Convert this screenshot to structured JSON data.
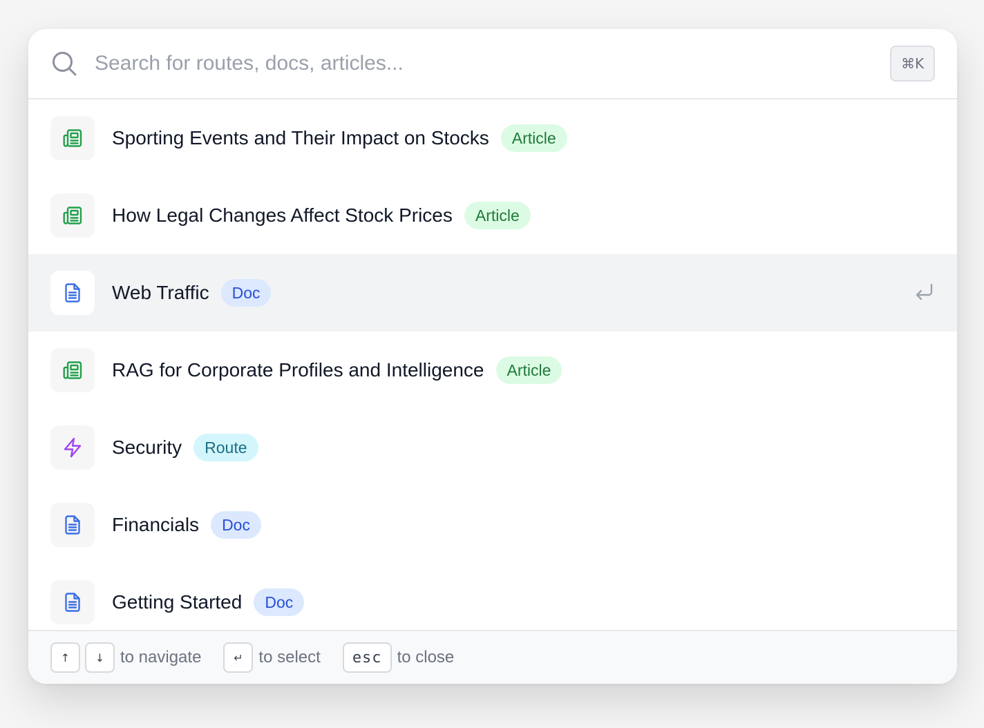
{
  "search": {
    "placeholder": "Search for routes, docs, articles...",
    "shortcut": "⌘K"
  },
  "results": [
    {
      "title": "Sporting Events and Their Impact on Stocks",
      "badge": "Article",
      "icon": "newspaper-icon"
    },
    {
      "title": "How Legal Changes Affect Stock Prices",
      "badge": "Article",
      "icon": "newspaper-icon"
    },
    {
      "title": "Web Traffic",
      "badge": "Doc",
      "icon": "document-icon",
      "selected": true
    },
    {
      "title": "RAG for Corporate Profiles and Intelligence",
      "badge": "Article",
      "icon": "newspaper-icon"
    },
    {
      "title": "Security",
      "badge": "Route",
      "icon": "lightning-bolt-icon"
    },
    {
      "title": "Financials",
      "badge": "Doc",
      "icon": "document-icon"
    },
    {
      "title": "Getting Started",
      "badge": "Doc",
      "icon": "document-icon"
    }
  ],
  "footer": {
    "up_key": "↑",
    "down_key": "↓",
    "navigate_label": "to navigate",
    "enter_key": "↵",
    "select_label": "to select",
    "esc_key": "esc",
    "close_label": "to close"
  },
  "colors": {
    "article_icon": "#22a04b",
    "doc_icon": "#3b6fe4",
    "route_icon": "#a044f0",
    "article_badge_bg": "#dcfbe4",
    "doc_badge_bg": "#dbe8fe",
    "route_badge_bg": "#d2f6fb",
    "selected_row_bg": "#f2f3f5"
  }
}
